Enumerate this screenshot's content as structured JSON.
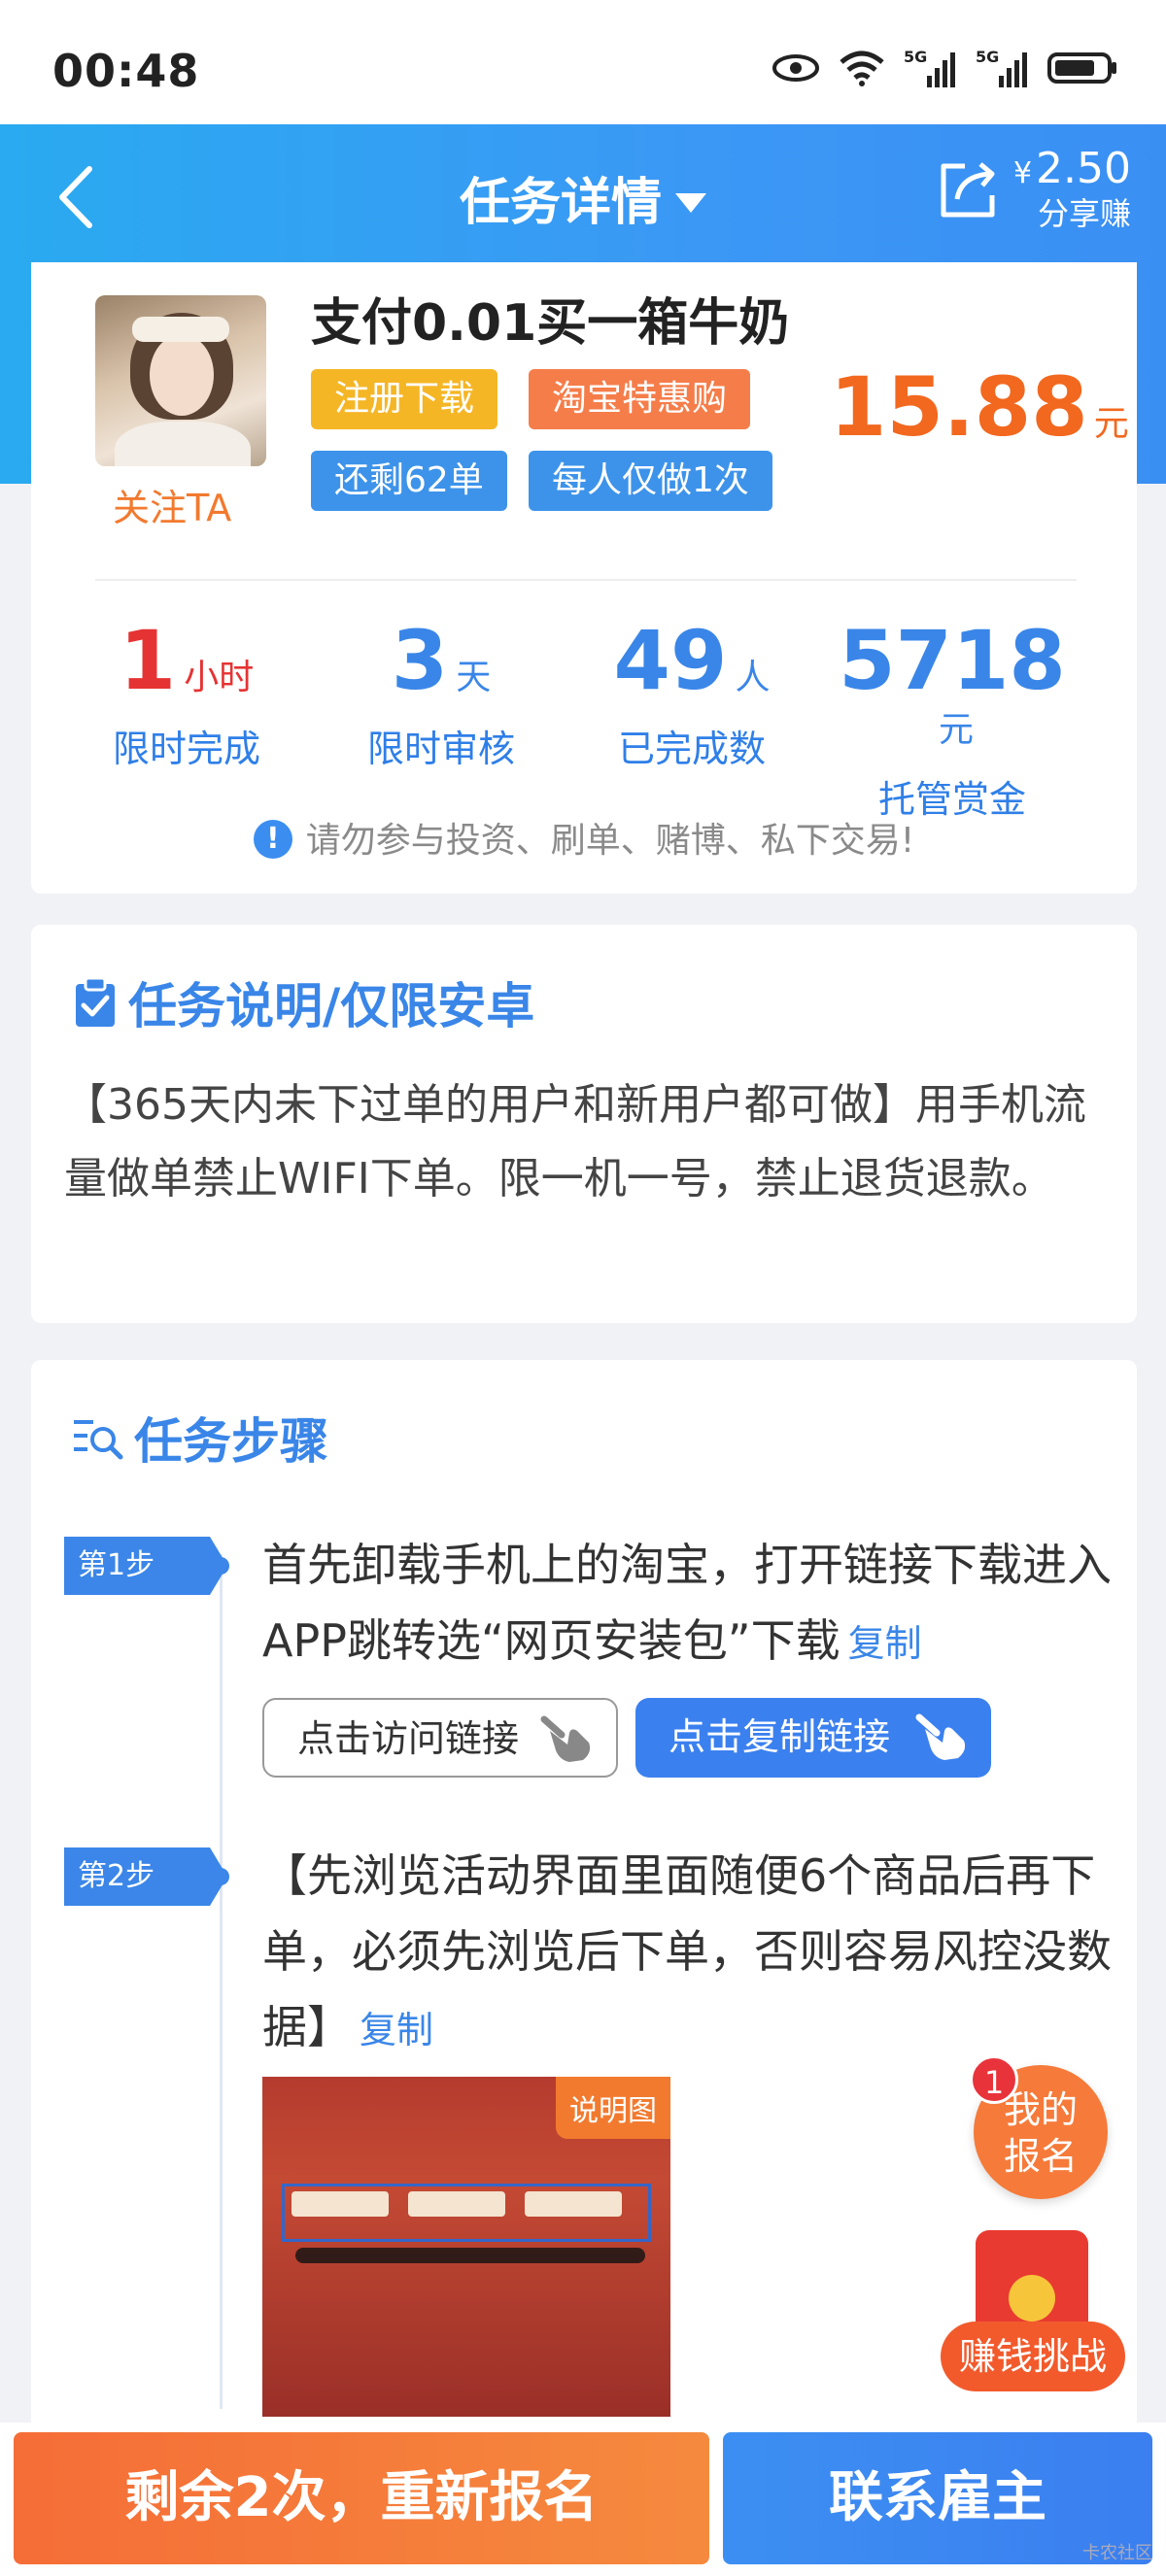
{
  "status_bar": {
    "time": "00:48",
    "network1": "5G",
    "network2": "5G"
  },
  "header": {
    "title": "任务详情",
    "share_currency": "¥",
    "share_amount": "2.50",
    "share_label": "分享赚",
    "colors": {
      "primary": "#3a8ff3",
      "accent_orange": "#f2681f"
    }
  },
  "task": {
    "title": "支付0.01买一箱牛奶",
    "follow_label": "关注TA",
    "tags": [
      "注册下载",
      "淘宝特惠购",
      "还剩62单",
      "每人仅做1次"
    ],
    "price": "15.88",
    "price_unit": "元",
    "stats": [
      {
        "value": "1",
        "unit": "小时",
        "label": "限时完成"
      },
      {
        "value": "3",
        "unit": "天",
        "label": "限时审核"
      },
      {
        "value": "49",
        "unit": "人",
        "label": "已完成数"
      },
      {
        "value": "5718",
        "unit": "元",
        "label": "托管赏金"
      }
    ],
    "warning": "请勿参与投资、刷单、赌博、私下交易!"
  },
  "description": {
    "title": "任务说明/仅限安卓",
    "text": "【365天内未下过单的用户和新用户都可做】用手机流量做单禁止WIFI下单。限一机一号，禁止退货退款。"
  },
  "steps": {
    "title": "任务步骤",
    "items": [
      {
        "badge": "第1步",
        "text": "首先卸载手机上的淘宝，打开链接下载进入APP跳转选“网页安装包”下载",
        "copy_label": "复制",
        "visit_button": "点击访问链接",
        "copy_button": "点击复制链接"
      },
      {
        "badge": "第2步",
        "text": "【先浏览活动界面里面随便6个商品后再下单，必须先浏览后下单，否则容易风控没数据】",
        "copy_label": "复制",
        "image_badge": "说明图"
      }
    ]
  },
  "floating": {
    "register_badge": "1",
    "register_line1": "我的",
    "register_line2": "报名",
    "challenge": "赚钱挑战"
  },
  "bottom": {
    "left_button": "剩余2次，重新报名",
    "right_button": "联系雇主",
    "watermark": "卡农社区"
  }
}
